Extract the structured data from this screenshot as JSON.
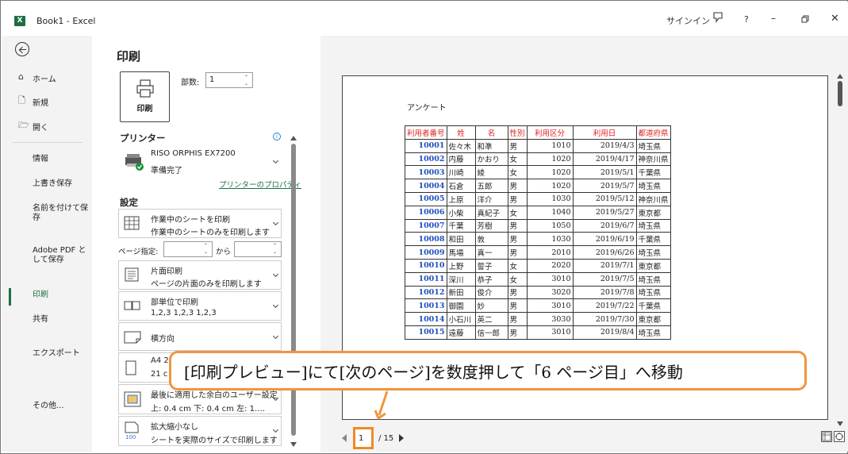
{
  "titlebar": {
    "app_title": "Book1 - Excel",
    "signin": "サインイン"
  },
  "nav": {
    "home": "ホーム",
    "new": "新規",
    "open": "開く",
    "info": "情報",
    "save": "上書き保存",
    "save_as": "名前を付けて保存",
    "adobe_pdf": "Adobe PDF として保存",
    "print": "印刷",
    "share": "共有",
    "export": "エクスポート",
    "more": "その他..."
  },
  "print_panel": {
    "heading": "印刷",
    "print_button": "印刷",
    "copies_label": "部数:",
    "copies_value": "1",
    "printer_heading": "プリンター",
    "printer_name": "RISO ORPHIS EX7200",
    "printer_status": "準備完了",
    "printer_properties": "プリンターのプロパティ",
    "settings_heading": "設定",
    "scope_title": "作業中のシートを印刷",
    "scope_desc": "作業中のシートのみを印刷します",
    "pages_label": "ページ指定:",
    "pages_to": "から",
    "sides_title": "片面印刷",
    "sides_desc": "ページの片面のみを印刷します",
    "collate_title": "部単位で印刷",
    "collate_desc": "1,2,3   1,2,3   1,2,3",
    "orientation": "横方向",
    "paper_title": "A4 2",
    "paper_desc": "21 c",
    "margins_title": "最後に適用した余白のユーザー設定",
    "margins_desc": "上: 0.4 cm 下: 0.4 cm 左: 1.…",
    "scaling_title": "拡大縮小なし",
    "scaling_desc": "シートを実際のサイズで印刷します"
  },
  "preview": {
    "sheet_title": "アンケート",
    "headers": [
      "利用者番号",
      "姓",
      "名",
      "性別",
      "利用区分",
      "利用日",
      "都道府県"
    ],
    "rows": [
      [
        "10001",
        "佐々木",
        "和準",
        "男",
        "1010",
        "2019/4/3",
        "埼玉県"
      ],
      [
        "10002",
        "内藤",
        "かおり",
        "女",
        "1020",
        "2019/4/17",
        "神奈川県"
      ],
      [
        "10003",
        "川崎",
        "綾",
        "女",
        "1020",
        "2019/5/1",
        "千葉県"
      ],
      [
        "10004",
        "石倉",
        "五郎",
        "男",
        "1020",
        "2019/5/7",
        "埼玉県"
      ],
      [
        "10005",
        "上原",
        "洋介",
        "男",
        "1030",
        "2019/5/12",
        "神奈川県"
      ],
      [
        "10006",
        "小柴",
        "真紀子",
        "女",
        "1040",
        "2019/5/27",
        "東京都"
      ],
      [
        "10007",
        "千葉",
        "芳樹",
        "男",
        "1050",
        "2019/6/7",
        "埼玉県"
      ],
      [
        "10008",
        "和田",
        "敦",
        "男",
        "1030",
        "2019/6/19",
        "千葉県"
      ],
      [
        "10009",
        "馬場",
        "真一",
        "男",
        "2010",
        "2019/6/26",
        "埼玉県"
      ],
      [
        "10010",
        "上野",
        "誓子",
        "女",
        "2020",
        "2019/7/1",
        "東京都"
      ],
      [
        "10011",
        "深川",
        "恭子",
        "女",
        "3010",
        "2019/7/5",
        "埼玉県"
      ],
      [
        "10012",
        "新田",
        "俊介",
        "男",
        "3020",
        "2019/7/8",
        "埼玉県"
      ],
      [
        "10013",
        "御園",
        "妙",
        "男",
        "3010",
        "2019/7/22",
        "千葉県"
      ],
      [
        "10014",
        "小石川",
        "英二",
        "男",
        "3030",
        "2019/7/30",
        "東京都"
      ],
      [
        "10015",
        "遠藤",
        "信一郎",
        "男",
        "3010",
        "2019/8/4",
        "埼玉県"
      ]
    ],
    "current_page": "1",
    "total_pages": "/ 15"
  },
  "callout": {
    "text": "[印刷プレビュー]にて[次のページ]を数度押して「6 ページ目」へ移動"
  },
  "colors": {
    "accent": "#1d6f42",
    "header_red": "#e02020",
    "id_blue": "#1f4fbf",
    "callout_orange": "#f0963c"
  }
}
